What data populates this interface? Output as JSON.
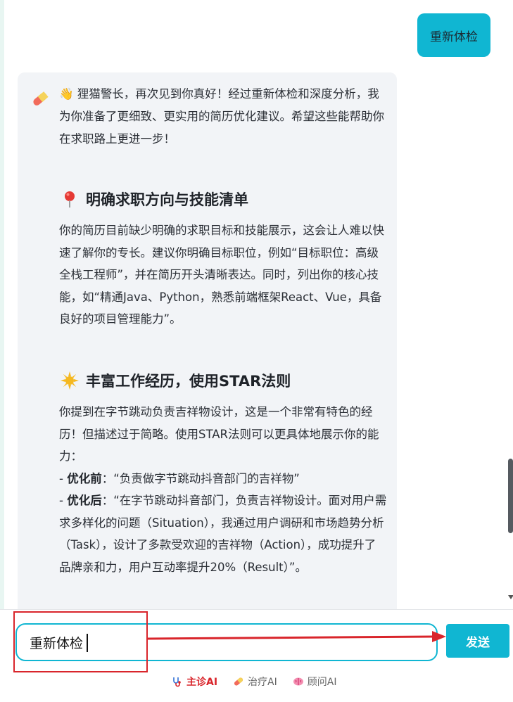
{
  "chat": {
    "user_message": "重新体检",
    "ai_intro": "👋 狸猫警长，再次见到你真好！经过重新体检和深度分析，我为你准备了更细致、更实用的简历优化建议。希望这些能帮助你在求职路上更进一步！",
    "section1": {
      "title": "明确求职方向与技能清单",
      "body": "你的简历目前缺少明确的求职目标和技能展示，这会让人难以快速了解你的专长。建议你明确目标职位，例如“目标职位：高级全栈工程师”，并在简历开头清晰表达。同时，列出你的核心技能，如“精通Java、Python，熟悉前端框架React、Vue，具备良好的项目管理能力”。"
    },
    "section2": {
      "title": "丰富工作经历，使用STAR法则",
      "body": "你提到在字节跳动负责吉祥物设计，这是一个非常有特色的经历！但描述过于简略。使用STAR法则可以更具体地展示你的能力：",
      "before_label": "优化前",
      "before_text": "：“负责做字节跳动抖音部门的吉祥物”",
      "after_label": "优化后",
      "after_text": "：“在字节跳动抖音部门，负责吉祥物设计。面对用户需求多样化的问题（Situation），我通过用户调研和市场趋势分析（Task），设计了多款受欢迎的吉祥物（Action），成功提升了品牌亲和力，用户互动率提升20%（Result）”。",
      "bullet": "- "
    }
  },
  "input": {
    "value": "重新体检",
    "send_label": "发送"
  },
  "modes": [
    {
      "label": "主诊AI",
      "active": true
    },
    {
      "label": "治疗AI",
      "active": false
    },
    {
      "label": "顾问AI",
      "active": false
    }
  ],
  "colors": {
    "accent": "#10b6d2",
    "annotation": "#d9252b",
    "card_bg": "#f2f4f7"
  }
}
